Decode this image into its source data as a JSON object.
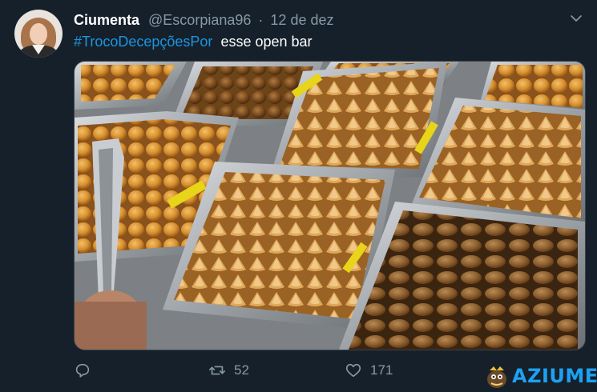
{
  "tweet": {
    "author_name": "Ciumenta",
    "handle": "@Escorpiana96",
    "separator": "·",
    "date": "12 de dez",
    "hashtag": "#TrocoDecepçõesPor",
    "text": "esse open bar"
  },
  "actions": {
    "reply_icon": "reply-icon",
    "retweet_icon": "retweet-icon",
    "retweet_count": "52",
    "like_icon": "heart-icon",
    "like_count": "171"
  },
  "watermark": {
    "text": "AZIUME"
  },
  "colors": {
    "background": "#15202b",
    "secondary_text": "#8899a6",
    "link": "#1b95e0",
    "watermark": "#1da1f2"
  }
}
